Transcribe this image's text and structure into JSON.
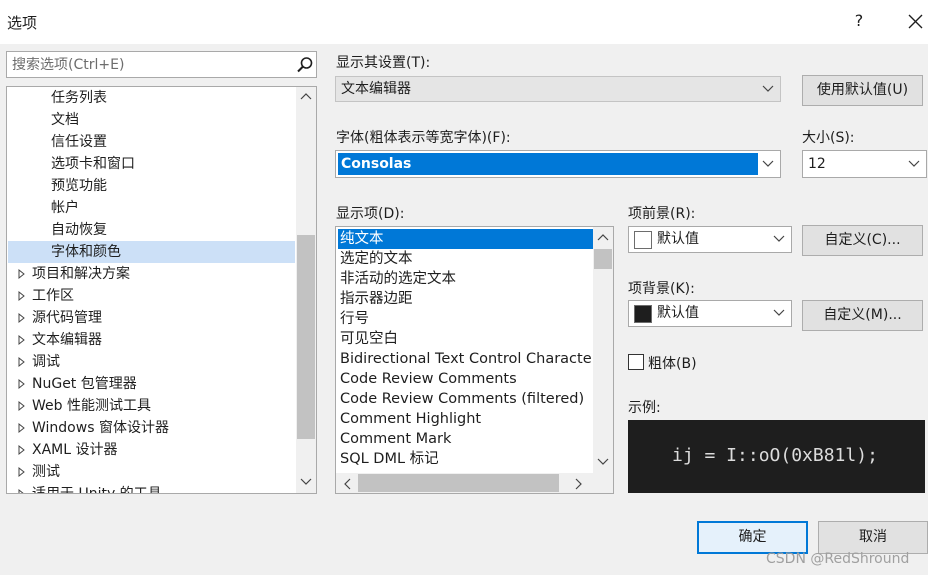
{
  "window": {
    "title": "选项",
    "help_label": "?"
  },
  "search": {
    "placeholder": "搜索选项(Ctrl+E)"
  },
  "tree": {
    "children": [
      "任务列表",
      "文档",
      "信任设置",
      "选项卡和窗口",
      "预览功能",
      "帐户",
      "自动恢复",
      "字体和颜色"
    ],
    "selected": "字体和颜色",
    "groups": [
      "项目和解决方案",
      "工作区",
      "源代码管理",
      "文本编辑器",
      "调试",
      "NuGet 包管理器",
      "Web 性能测试工具",
      "Windows 窗体设计器",
      "XAML 设计器",
      "测试",
      "适用于 Unity 的工具"
    ]
  },
  "settings": {
    "show_settings_label": "显示其设置(T):",
    "show_settings_value": "文本编辑器",
    "use_defaults_button": "使用默认值(U)",
    "font_label": "字体(粗体表示等宽字体)(F):",
    "font_value": "Consolas",
    "size_label": "大小(S):",
    "size_value": "12",
    "display_items_label": "显示项(D):",
    "display_items": [
      "纯文本",
      "选定的文本",
      "非活动的选定文本",
      "指示器边距",
      "行号",
      "可见空白",
      "Bidirectional Text Control Character",
      "Code Review Comments",
      "Code Review Comments (filtered)",
      "Comment Highlight",
      "Comment Mark",
      "SQL DML 标记"
    ],
    "selected_item": "纯文本",
    "foreground_label": "项前景(R):",
    "foreground_value": "默认值",
    "foreground_color": "#ffffff",
    "custom_fg_button": "自定义(C)...",
    "background_label": "项背景(K):",
    "background_value": "默认值",
    "background_color": "#1e1e1e",
    "custom_bg_button": "自定义(M)...",
    "bold_label": "粗体(B)",
    "bold_checked": false,
    "sample_label": "示例:",
    "sample_text": "ij = I::oO(0xB81l);"
  },
  "footer": {
    "ok_button": "确定",
    "cancel_button": "取消",
    "watermark": "CSDN @RedShround"
  },
  "colors": {
    "accent": "#0078d7",
    "tree_selected": "#cce0f7",
    "sample_background": "#1e1e1e"
  }
}
